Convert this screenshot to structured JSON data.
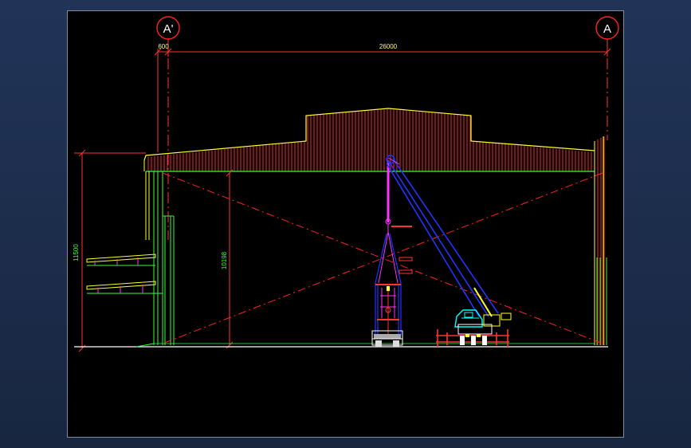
{
  "drawing": {
    "grid_bubbles": {
      "left": "A'",
      "right": "A"
    },
    "dimensions": {
      "left_offset": "600",
      "span": "26000",
      "total_height": "11500",
      "clear_height": "10198"
    },
    "colors": {
      "background": "#000000",
      "roof": "#ff3333",
      "roof_edge": "#ffff00",
      "columns": "#33ff33",
      "centerline": "#ff2222",
      "crane_boom": "#2233ff",
      "crane_cab": "#00ffff",
      "hook_line": "#ff33ff",
      "dim_lines": "#ff3333",
      "dim_text": "#ffff66"
    }
  }
}
